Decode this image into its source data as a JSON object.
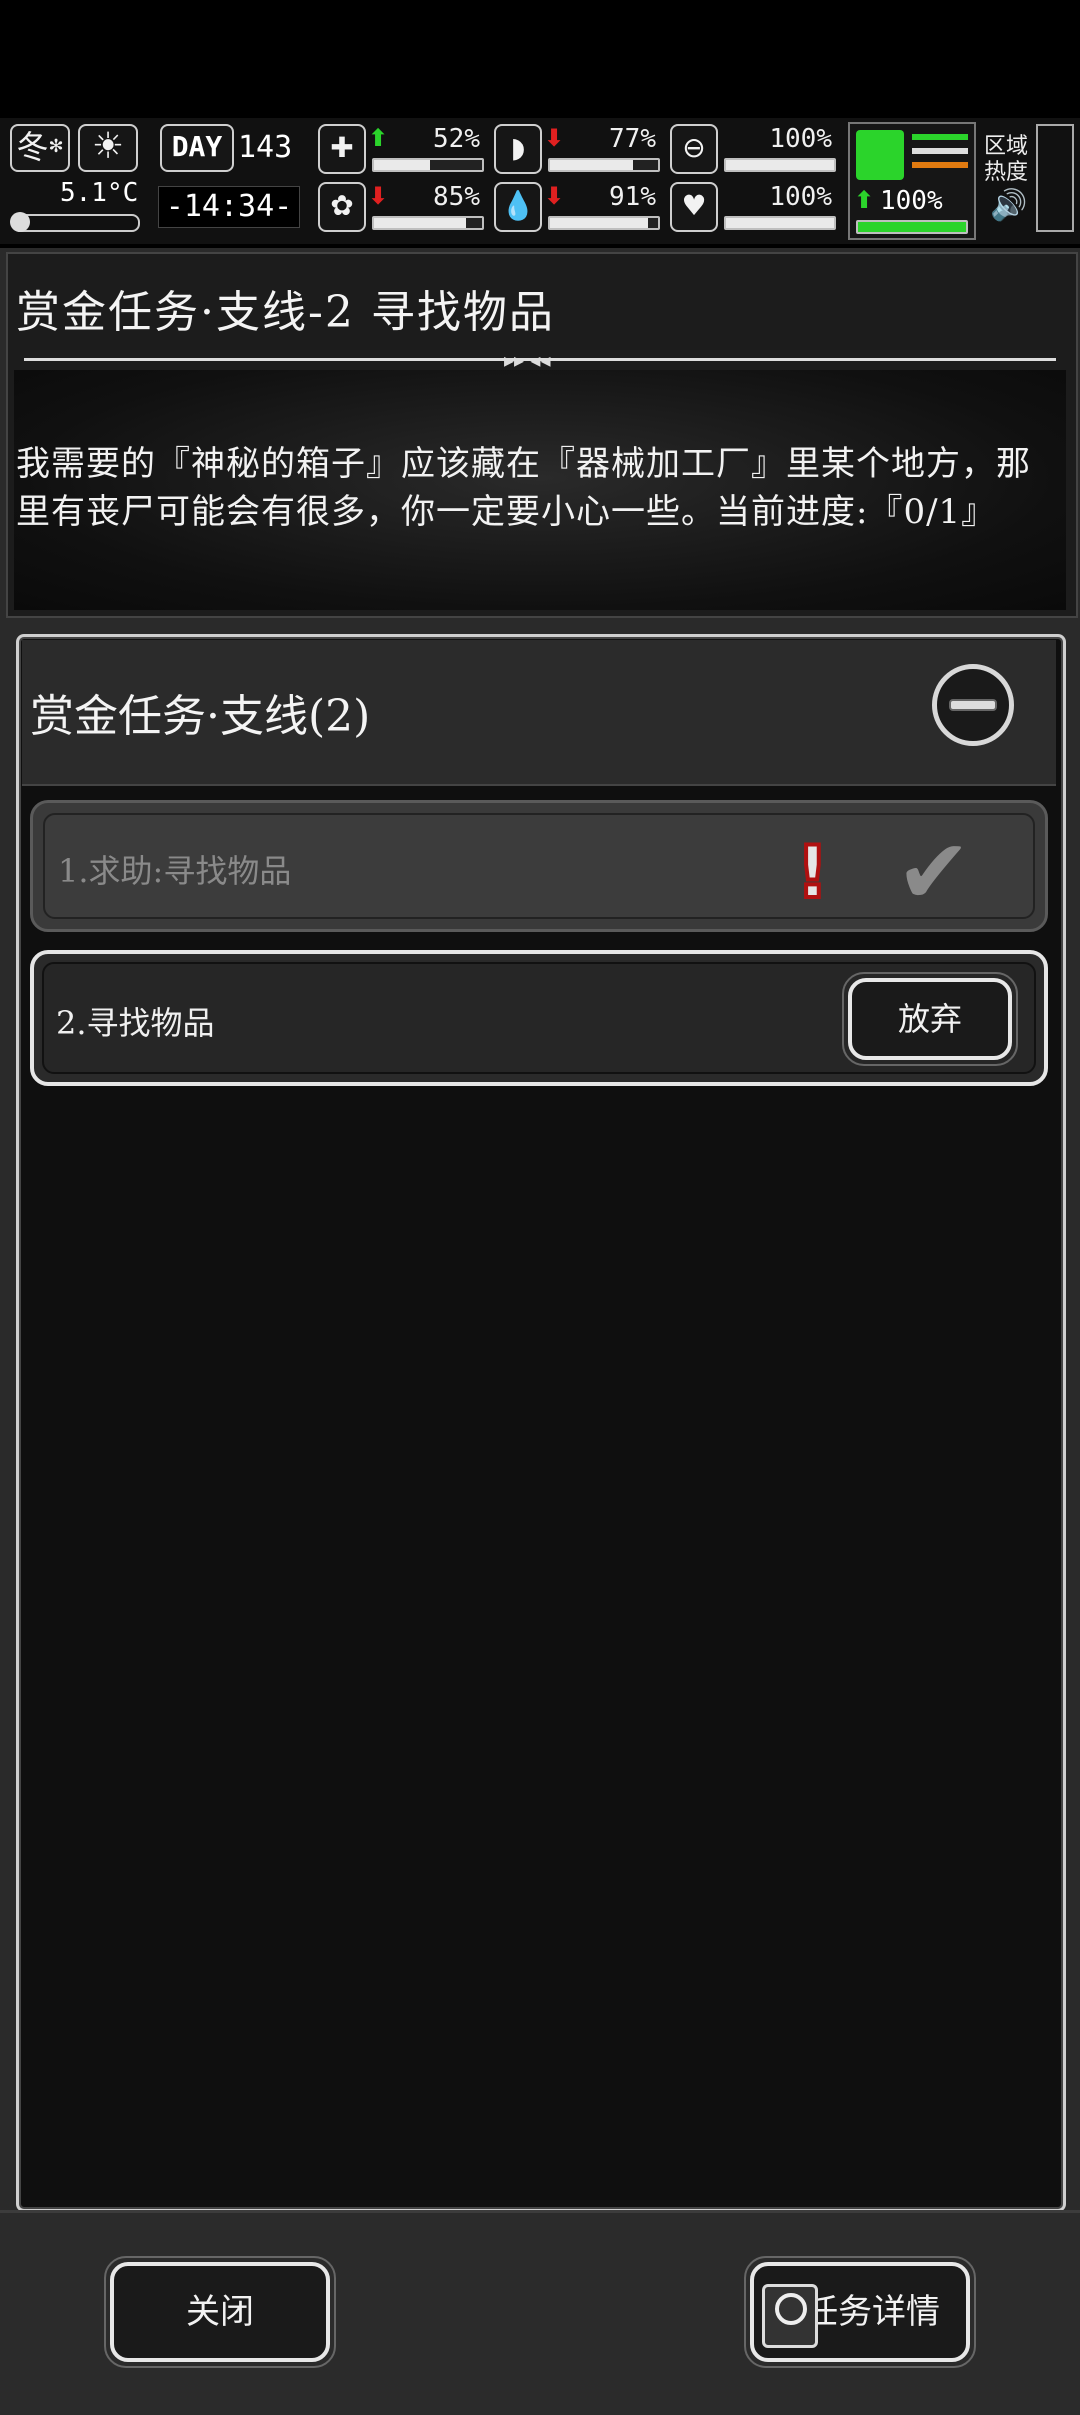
{
  "hud": {
    "season": "冬",
    "weather_icon": "sun-icon",
    "temperature": "5.1°C",
    "day_label": "DAY",
    "day_number": "143",
    "clock": "-14:34-",
    "stats": [
      {
        "name": "health",
        "icon": "medkit-icon",
        "trend": "up",
        "value": "52%",
        "level": 0.52
      },
      {
        "name": "stomach",
        "icon": "stomach-icon",
        "trend": "down",
        "value": "77%",
        "level": 0.77
      },
      {
        "name": "pill",
        "icon": "pill-icon",
        "trend": "none",
        "value": "100%",
        "level": 1.0
      },
      {
        "name": "brain",
        "icon": "brain-icon",
        "trend": "down",
        "value": "85%",
        "level": 0.85
      },
      {
        "name": "water",
        "icon": "water-drop-icon",
        "trend": "down",
        "value": "91%",
        "level": 0.91
      },
      {
        "name": "heart",
        "icon": "heart-icon",
        "trend": "none",
        "value": "100%",
        "level": 1.0
      }
    ],
    "stamina": {
      "icon": "boot-icon",
      "trend": "up",
      "value": "100%",
      "level": 1.0
    },
    "region_heat_label": "区域\n热度",
    "region_heat_line1": "区域",
    "region_heat_line2": "热度",
    "volume_icon": "speaker-icon"
  },
  "quest": {
    "title": "赏金任务·支线-2 寻找物品",
    "description": "我需要的『神秘的箱子』应该藏在『器械加工厂』里某个地方，那里有丧尸可能会有很多，你一定要小心一些。当前进度:『0/1』"
  },
  "list": {
    "header": "赏金任务·支线(2)",
    "items": [
      {
        "label": "1.求助:寻找物品",
        "completed": true
      },
      {
        "label": "2.寻找物品",
        "action": "放弃"
      }
    ]
  },
  "footer": {
    "close_label": "关闭",
    "details_label": "任务详情"
  },
  "colors": {
    "up": "#2bd42b",
    "down": "#e02020",
    "alert": "#b01010"
  }
}
